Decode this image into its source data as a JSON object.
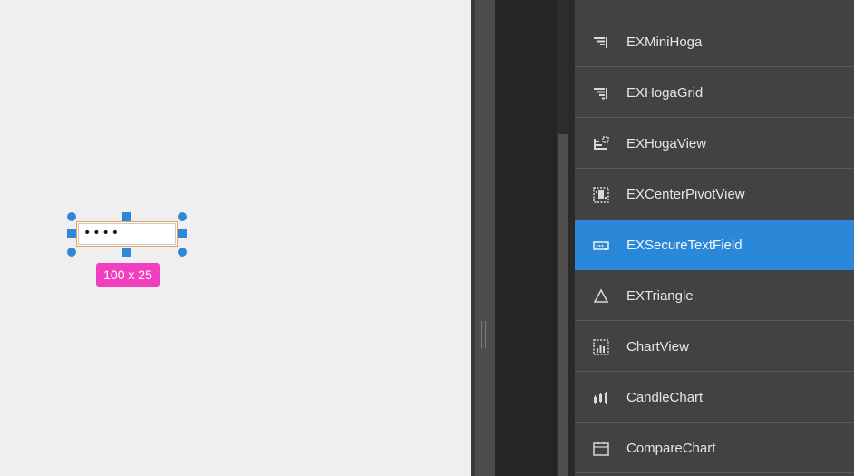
{
  "canvas": {
    "secure_field_value": "••••",
    "size_badge": "100 x 25"
  },
  "components": [
    {
      "label": "EXMiniHoga",
      "icon": "hoga-bars-icon"
    },
    {
      "label": "EXHogaGrid",
      "icon": "hoga-grid-icon"
    },
    {
      "label": "EXHogaView",
      "icon": "hoga-view-icon"
    },
    {
      "label": "EXCenterPivotView",
      "icon": "pivot-view-icon"
    },
    {
      "label": "EXSecureTextField",
      "icon": "secure-textfield-icon",
      "selected": true
    },
    {
      "label": "EXTriangle",
      "icon": "triangle-icon"
    },
    {
      "label": "ChartView",
      "icon": "chart-view-icon"
    },
    {
      "label": "CandleChart",
      "icon": "candle-chart-icon"
    },
    {
      "label": "CompareChart",
      "icon": "compare-chart-icon"
    }
  ],
  "colors": {
    "selection_accent": "#2b88d8",
    "size_badge": "#f23fbf",
    "selected_outline": "#f0a04b",
    "panel_bg": "#424242"
  }
}
